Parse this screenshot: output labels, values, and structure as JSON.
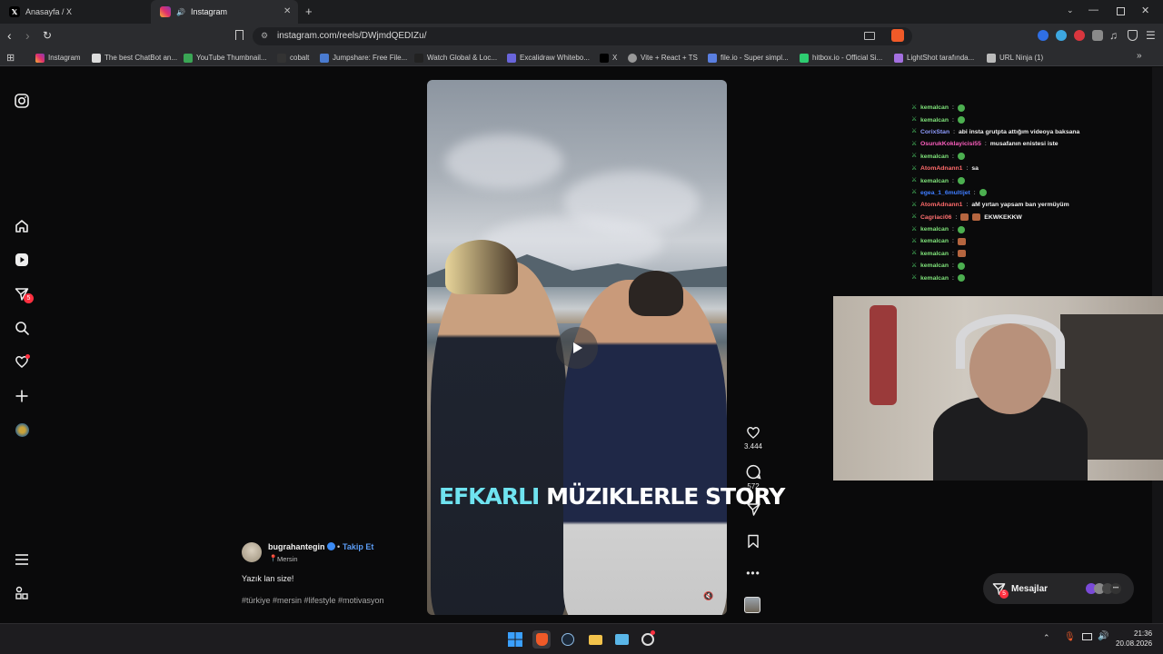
{
  "browser": {
    "tabs": [
      {
        "label": "Anasayfa / X",
        "icon": "x-logo-icon"
      },
      {
        "label": "Instagram",
        "icon": "instagram-icon",
        "active": true
      }
    ],
    "url": "instagram.com/reels/DWjmdQEDIZu/",
    "bookmarks": [
      "Instagram",
      "The best ChatBot an...",
      "YouTube Thumbnail...",
      "cobalt",
      "Jumpshare: Free File...",
      "Watch Global & Loc...",
      "Excalidraw Whitebo...",
      "X",
      "Vite + React + TS",
      "file.io - Super simpl...",
      "hitbox.io - Official Si...",
      "LightShot tarafında...",
      "URL Ninja (1)"
    ]
  },
  "sidebar": {
    "notification_count": "5"
  },
  "video": {
    "caption_part1": "EFKARLI",
    "caption_part2": "MÜZIKLERLE STORY"
  },
  "actions": {
    "likes": "3.444",
    "comments": "572"
  },
  "post": {
    "username": "bugrahantegin",
    "follow_label": "Takip Et",
    "location": "Mersin",
    "description": "Yazık lan size!",
    "hashtags": "#türkiye #mersin #lifestyle #motivasyon"
  },
  "chat": {
    "lines": [
      {
        "user": "kemalcan",
        "color": "#7fe27a",
        "text": "",
        "emote": "green"
      },
      {
        "user": "kemalcan",
        "color": "#7fe27a",
        "text": "",
        "emote": "green"
      },
      {
        "user": "CorixStan",
        "color": "#8f9cff",
        "text": "abi insta grutpta attığım videoya baksana",
        "emote": ""
      },
      {
        "user": "OsurukKoklayicisi55",
        "color": "#ff5fc0",
        "text": "musafanın enistesi iste",
        "emote": ""
      },
      {
        "user": "kemalcan",
        "color": "#7fe27a",
        "text": "",
        "emote": "green"
      },
      {
        "user": "AtomAdnann1",
        "color": "#ff6b6b",
        "text": "sa",
        "emote": ""
      },
      {
        "user": "kemalcan",
        "color": "#7fe27a",
        "text": "",
        "emote": "green"
      },
      {
        "user": "egea_1_6multijet",
        "color": "#3f7dff",
        "text": "",
        "emote": "green"
      },
      {
        "user": "AtomAdnann1",
        "color": "#ff6b6b",
        "text": "aM yırtan yapsam ban yermüyüm",
        "emote": ""
      },
      {
        "user": "Cagriaci06",
        "color": "#ff7070",
        "text": "EKWKEKKW",
        "emote": "face"
      },
      {
        "user": "kemalcan",
        "color": "#7fe27a",
        "text": "",
        "emote": "green"
      },
      {
        "user": "kemalcan",
        "color": "#7fe27a",
        "text": "",
        "emote": "face"
      },
      {
        "user": "kemalcan",
        "color": "#7fe27a",
        "text": "",
        "emote": "face"
      },
      {
        "user": "kemalcan",
        "color": "#7fe27a",
        "text": "",
        "emote": "green"
      },
      {
        "user": "kemalcan",
        "color": "#7fe27a",
        "text": "",
        "emote": "green"
      }
    ]
  },
  "messages_button": {
    "label": "Mesajlar",
    "badge": "5"
  },
  "taskbar": {
    "time": "21:36",
    "date": "20.08.2026"
  },
  "colors": {
    "accent_blue": "#5b9cf5",
    "caption_cyan": "#6fe3f0",
    "badge_red": "#ff3040"
  }
}
